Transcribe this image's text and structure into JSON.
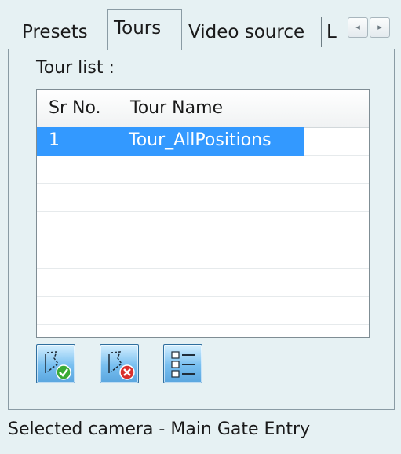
{
  "tabs": [
    {
      "label": "Presets"
    },
    {
      "label": "Tours",
      "active": true
    },
    {
      "label": "Video source"
    },
    {
      "label": "L"
    }
  ],
  "tab_scroll": {
    "left_icon": "arrow-left-icon",
    "right_icon": "arrow-right-icon",
    "left_glyph": "◂",
    "right_glyph": "▸"
  },
  "tour_list": {
    "label": "Tour list :",
    "columns": [
      "Sr No.",
      "Tour Name"
    ],
    "rows": [
      {
        "sr": "1",
        "name": "Tour_AllPositions",
        "selected": true
      }
    ]
  },
  "toolbar": {
    "buttons": [
      {
        "icon": "add-tour-icon"
      },
      {
        "icon": "delete-tour-icon"
      },
      {
        "icon": "tour-list-details-icon"
      }
    ]
  },
  "status": {
    "text": "Selected camera - Main Gate Entry"
  },
  "colors": {
    "background": "#e6f1f3",
    "selection": "#3399ff",
    "button": "#78bff0"
  }
}
